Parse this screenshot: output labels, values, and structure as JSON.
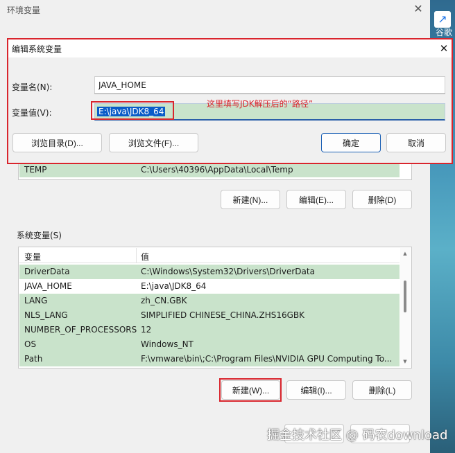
{
  "background_window": {
    "title": "环境变量",
    "close": "✕"
  },
  "desktop": {
    "label": "谷歌"
  },
  "edit_dialog": {
    "title": "编辑系统变量",
    "close": "✕",
    "name_label": "变量名(N):",
    "name_value": "JAVA_HOME",
    "value_label": "变量值(V):",
    "value_value": "E:\\java\\JDK8_64",
    "annotation": "这里填写JDK解压后的“路径”",
    "browse_dir": "浏览目录(D)...",
    "browse_file": "浏览文件(F)...",
    "ok": "确定",
    "cancel": "取消"
  },
  "user_vars": {
    "partial_row": {
      "name": "TEMP",
      "value": "C:\\Users\\40396\\AppData\\Local\\Temp"
    },
    "new": "新建(N)...",
    "edit": "编辑(E)...",
    "delete": "删除(D)"
  },
  "system_vars": {
    "group_label": "系统变量(S)",
    "columns": [
      "变量",
      "值"
    ],
    "rows": [
      {
        "name": "DriverData",
        "value": "C:\\Windows\\System32\\Drivers\\DriverData",
        "highlight": true
      },
      {
        "name": "JAVA_HOME",
        "value": "E:\\java\\JDK8_64",
        "highlight": false
      },
      {
        "name": "LANG",
        "value": "zh_CN.GBK",
        "highlight": true
      },
      {
        "name": "NLS_LANG",
        "value": "SIMPLIFIED CHINESE_CHINA.ZHS16GBK",
        "highlight": true
      },
      {
        "name": "NUMBER_OF_PROCESSORS",
        "value": "12",
        "highlight": true
      },
      {
        "name": "OS",
        "value": "Windows_NT",
        "highlight": true
      },
      {
        "name": "Path",
        "value": "F:\\vmware\\bin\\;C:\\Program Files\\NVIDIA GPU Computing To...",
        "highlight": true
      }
    ],
    "new": "新建(W)...",
    "edit": "编辑(I)...",
    "delete": "删除(L)"
  },
  "watermark": "掘金技术社区 @ 码农download",
  "colors": {
    "highlight_row": "#c9e3cb",
    "annotation_red": "#d9252d",
    "selection_blue": "#0a5cc8"
  }
}
